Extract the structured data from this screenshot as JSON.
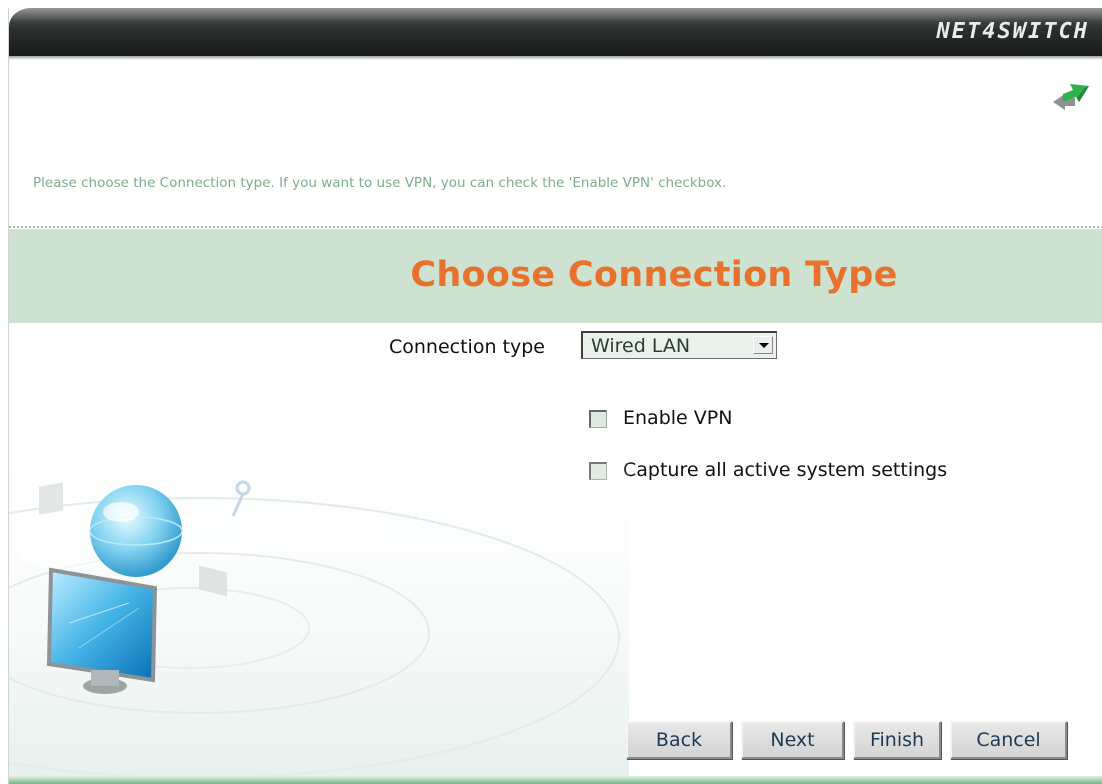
{
  "window": {
    "brand": "NET4SWITCH"
  },
  "wizard": {
    "instructions": "Please choose the Connection type. If you want to use VPN, you can check the 'Enable VPN' checkbox.",
    "title": "Choose Connection Type",
    "connection_type": {
      "label": "Connection type",
      "selected": "Wired LAN"
    },
    "checkboxes": [
      {
        "label": "Enable VPN",
        "checked": false
      },
      {
        "label": "Capture all active system settings",
        "checked": false
      }
    ],
    "buttons": {
      "back": "Back",
      "next": "Next",
      "finish": "Finish",
      "cancel": "Cancel"
    }
  },
  "colors": {
    "title_orange": "#e8722c",
    "band_green": "#cde2d1",
    "instruction_green": "#7cae8b"
  },
  "icons": {
    "nav": "sync-arrows-icon",
    "illustration": "network-computer-illustration"
  }
}
